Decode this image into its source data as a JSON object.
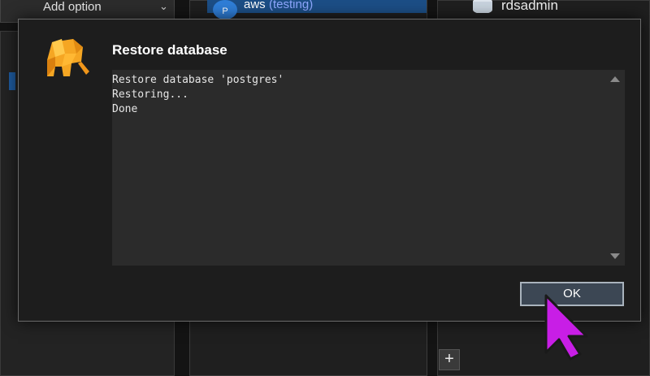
{
  "background": {
    "left_panel": {
      "add_option_label": "Add option",
      "chevron": "chevron-down-icon"
    },
    "server": {
      "avatar_letter": "P",
      "name": "aws",
      "tag": "(testing)"
    },
    "database": {
      "name": "rdsadmin",
      "icon": "database-icon"
    },
    "add_tab_label": "+"
  },
  "dialog": {
    "title": "Restore database",
    "logo": "elephant-logo-icon",
    "log_lines": "Restore database 'postgres'\nRestoring...\nDone",
    "ok_label": "OK"
  },
  "colors": {
    "dialog_bg": "#1d1d1d",
    "log_bg": "#2b2b2b",
    "selection_blue": "#1c4e86",
    "server_tag": "#8fa8ff",
    "cursor": "#c81ee6",
    "logo_orange": "#f5a623"
  }
}
